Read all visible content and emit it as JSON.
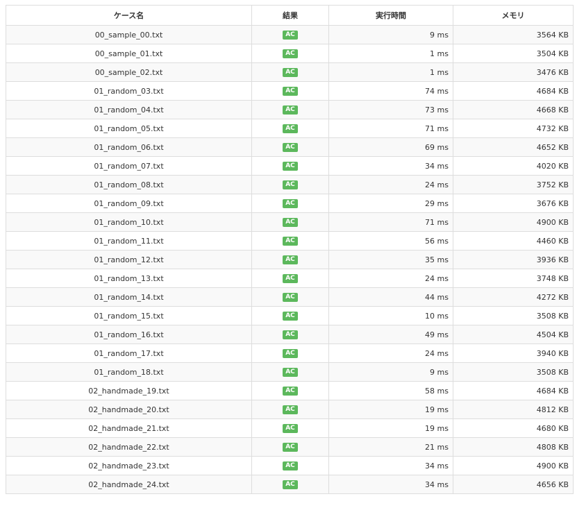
{
  "table": {
    "headers": {
      "case_name": "ケース名",
      "result": "結果",
      "exec_time": "実行時間",
      "memory": "メモリ"
    },
    "rows": [
      {
        "name": "00_sample_00.txt",
        "result": "AC",
        "time": "9 ms",
        "memory": "3564 KB"
      },
      {
        "name": "00_sample_01.txt",
        "result": "AC",
        "time": "1 ms",
        "memory": "3504 KB"
      },
      {
        "name": "00_sample_02.txt",
        "result": "AC",
        "time": "1 ms",
        "memory": "3476 KB"
      },
      {
        "name": "01_random_03.txt",
        "result": "AC",
        "time": "74 ms",
        "memory": "4684 KB"
      },
      {
        "name": "01_random_04.txt",
        "result": "AC",
        "time": "73 ms",
        "memory": "4668 KB"
      },
      {
        "name": "01_random_05.txt",
        "result": "AC",
        "time": "71 ms",
        "memory": "4732 KB"
      },
      {
        "name": "01_random_06.txt",
        "result": "AC",
        "time": "69 ms",
        "memory": "4652 KB"
      },
      {
        "name": "01_random_07.txt",
        "result": "AC",
        "time": "34 ms",
        "memory": "4020 KB"
      },
      {
        "name": "01_random_08.txt",
        "result": "AC",
        "time": "24 ms",
        "memory": "3752 KB"
      },
      {
        "name": "01_random_09.txt",
        "result": "AC",
        "time": "29 ms",
        "memory": "3676 KB"
      },
      {
        "name": "01_random_10.txt",
        "result": "AC",
        "time": "71 ms",
        "memory": "4900 KB"
      },
      {
        "name": "01_random_11.txt",
        "result": "AC",
        "time": "56 ms",
        "memory": "4460 KB"
      },
      {
        "name": "01_random_12.txt",
        "result": "AC",
        "time": "35 ms",
        "memory": "3936 KB"
      },
      {
        "name": "01_random_13.txt",
        "result": "AC",
        "time": "24 ms",
        "memory": "3748 KB"
      },
      {
        "name": "01_random_14.txt",
        "result": "AC",
        "time": "44 ms",
        "memory": "4272 KB"
      },
      {
        "name": "01_random_15.txt",
        "result": "AC",
        "time": "10 ms",
        "memory": "3508 KB"
      },
      {
        "name": "01_random_16.txt",
        "result": "AC",
        "time": "49 ms",
        "memory": "4504 KB"
      },
      {
        "name": "01_random_17.txt",
        "result": "AC",
        "time": "24 ms",
        "memory": "3940 KB"
      },
      {
        "name": "01_random_18.txt",
        "result": "AC",
        "time": "9 ms",
        "memory": "3508 KB"
      },
      {
        "name": "02_handmade_19.txt",
        "result": "AC",
        "time": "58 ms",
        "memory": "4684 KB"
      },
      {
        "name": "02_handmade_20.txt",
        "result": "AC",
        "time": "19 ms",
        "memory": "4812 KB"
      },
      {
        "name": "02_handmade_21.txt",
        "result": "AC",
        "time": "19 ms",
        "memory": "4680 KB"
      },
      {
        "name": "02_handmade_22.txt",
        "result": "AC",
        "time": "21 ms",
        "memory": "4808 KB"
      },
      {
        "name": "02_handmade_23.txt",
        "result": "AC",
        "time": "34 ms",
        "memory": "4900 KB"
      },
      {
        "name": "02_handmade_24.txt",
        "result": "AC",
        "time": "34 ms",
        "memory": "4656 KB"
      }
    ]
  },
  "colors": {
    "ac_badge": "#5cb85c",
    "border": "#dddddd",
    "stripe": "#f9f9f9"
  }
}
